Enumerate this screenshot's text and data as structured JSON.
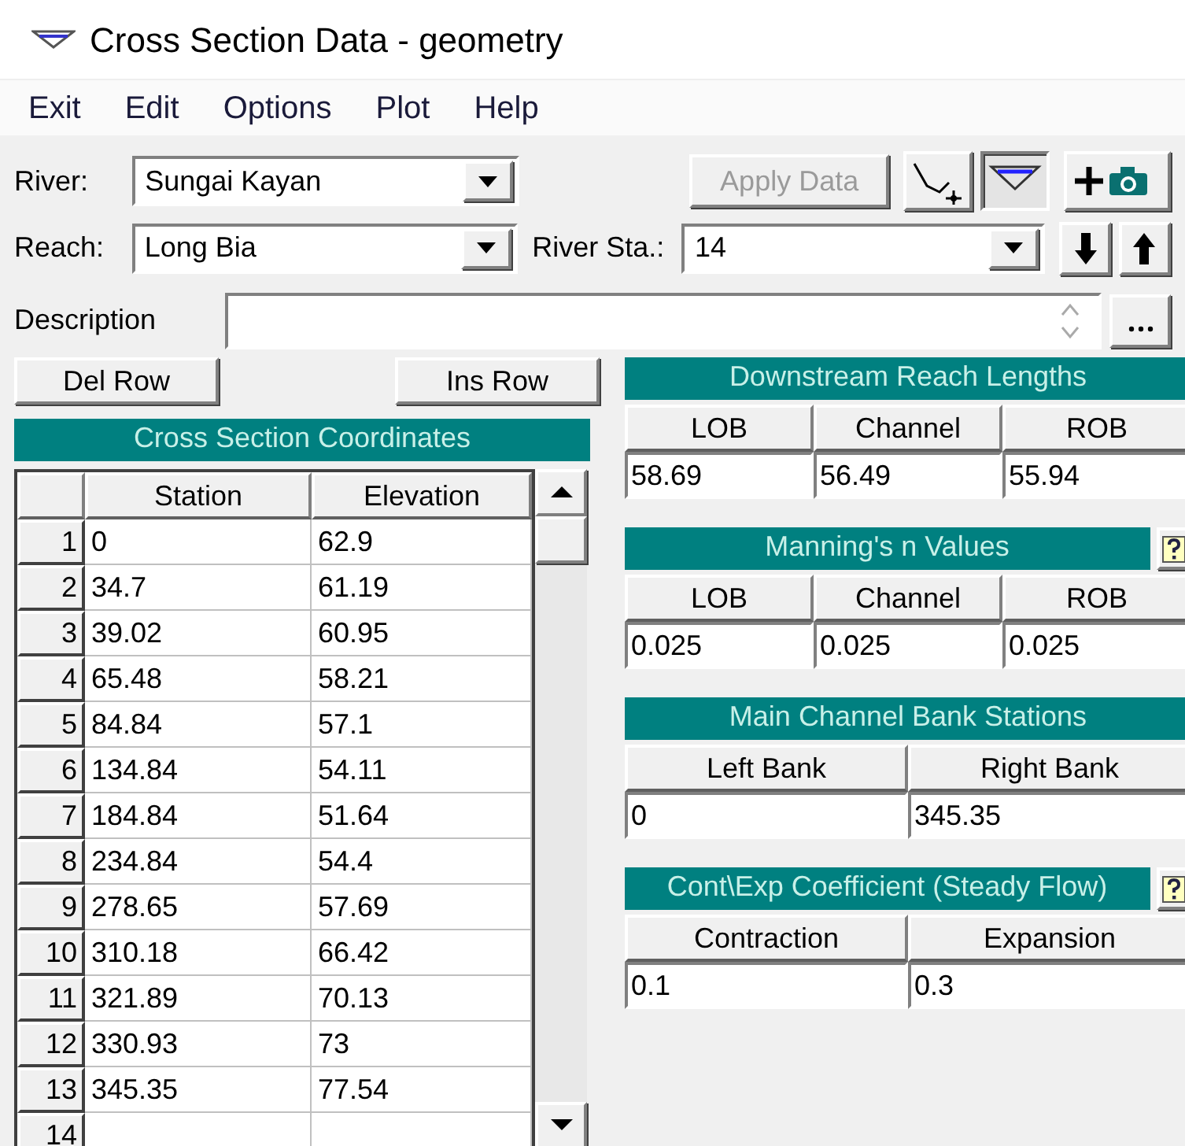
{
  "window": {
    "title": "Cross Section Data - geometry"
  },
  "menu": [
    "Exit",
    "Edit",
    "Options",
    "Plot",
    "Help"
  ],
  "river": {
    "label": "River:",
    "value": "Sungai Kayan"
  },
  "reach": {
    "label": "Reach:",
    "value": "Long Bia"
  },
  "river_sta": {
    "label": "River Sta.:",
    "value": "14"
  },
  "apply_button": {
    "label": "Apply Data",
    "disabled": true
  },
  "view_buttons": [
    {
      "kind": "edit",
      "selected": false
    },
    {
      "kind": "section",
      "selected": true
    }
  ],
  "description": {
    "label": "Description"
  },
  "row_buttons": [
    "Del Row",
    "Ins Row"
  ],
  "coordinates": {
    "title": "Cross Section Coordinates",
    "columns": [
      "Station",
      "Elevation"
    ],
    "rows": [
      {
        "index": "1",
        "station": "0",
        "elevation": "62.9"
      },
      {
        "index": "2",
        "station": "34.7",
        "elevation": "61.19"
      },
      {
        "index": "3",
        "station": "39.02",
        "elevation": "60.95"
      },
      {
        "index": "4",
        "station": "65.48",
        "elevation": "58.21"
      },
      {
        "index": "5",
        "station": "84.84",
        "elevation": "57.1"
      },
      {
        "index": "6",
        "station": "134.84",
        "elevation": "54.11"
      },
      {
        "index": "7",
        "station": "184.84",
        "elevation": "51.64"
      },
      {
        "index": "8",
        "station": "234.84",
        "elevation": "54.4"
      },
      {
        "index": "9",
        "station": "278.65",
        "elevation": "57.69"
      },
      {
        "index": "10",
        "station": "310.18",
        "elevation": "66.42"
      },
      {
        "index": "11",
        "station": "321.89",
        "elevation": "70.13"
      },
      {
        "index": "12",
        "station": "330.93",
        "elevation": "73"
      },
      {
        "index": "13",
        "station": "345.35",
        "elevation": "77.54"
      },
      {
        "index": "14"
      }
    ]
  },
  "panels": [
    {
      "title": "Downstream Reach Lengths",
      "help": false,
      "columns": [
        "LOB",
        "Channel",
        "ROB"
      ],
      "values": [
        "58.69",
        "56.49",
        "55.94"
      ]
    },
    {
      "title": "Manning's n Values",
      "help": true,
      "columns": [
        "LOB",
        "Channel",
        "ROB"
      ],
      "values": [
        "0.025",
        "0.025",
        "0.025"
      ]
    },
    {
      "title": "Main Channel Bank Stations",
      "help": false,
      "columns": [
        "Left Bank",
        "Right Bank"
      ],
      "values": [
        "0",
        "345.35"
      ]
    },
    {
      "title": "Cont\\Exp Coefficient (Steady Flow)",
      "help": true,
      "columns": [
        "Contraction",
        "Expansion"
      ],
      "values": [
        "0.1",
        "0.3"
      ]
    }
  ]
}
